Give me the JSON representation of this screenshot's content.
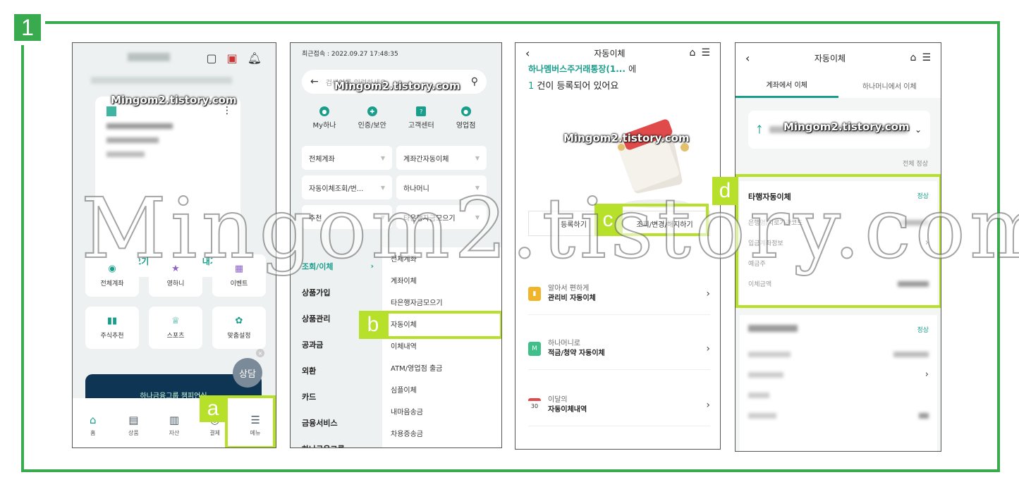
{
  "step": "1",
  "watermark": {
    "small": "Mingom2.tistory.com",
    "large": "Mingom2.tistory.com"
  },
  "callouts": {
    "a": "a",
    "b": "b",
    "c": "c",
    "d": "d"
  },
  "colors": {
    "frame": "#3aaa4f",
    "callout": "#b6e02a",
    "brand": "#1a9e8c"
  },
  "phone1": {
    "top_icons": [
      "wallet-icon",
      "qr-icon",
      "bell-icon"
    ],
    "card_buttons": [
      "가져오기",
      "보내기"
    ],
    "tiles": [
      "전체계좌",
      "영하니",
      "이벤트",
      "주식추천",
      "스포츠",
      "맞춤설정"
    ],
    "banner_text": "하나금융그룹 챔피언십",
    "consult": "상담",
    "nav": [
      "홈",
      "상품",
      "자산",
      "결제",
      "메뉴"
    ]
  },
  "phone2": {
    "last_login": "최근접속 : 2022.09.27 17:48:35",
    "search_placeholder": "검색어를 입력하세요",
    "quick": [
      "My하나",
      "인증/보안",
      "고객센터",
      "영업점"
    ],
    "chips": [
      "전체계좌",
      "계좌간자동이체",
      "자동이체조회/번...",
      "하나머니",
      "추천",
      "타은행자금모으기"
    ],
    "categories": [
      "조회/이체",
      "상품가입",
      "상품관리",
      "공과금",
      "외환",
      "카드",
      "금융서비스",
      "하나금융그룹"
    ],
    "sub_items": [
      "전체계좌",
      "계좌이체",
      "타은행자금모으기",
      "자동이체",
      "이체내역",
      "ATM/영업점 출금",
      "심플이체",
      "내마음송금",
      "차용증송금"
    ]
  },
  "phone3": {
    "title": "자동이체",
    "account_line": "하나멤버스주거래통장(1...",
    "account_suffix": "에",
    "count_num": "1",
    "count_text": " 건이 등록되어 있어요",
    "tab_register": "등록하기",
    "tab_manage": "조회/변경/해지하기",
    "rows": [
      {
        "sub": "알아서 편하게",
        "main": "관리비 자동이체"
      },
      {
        "sub": "하나머니로",
        "main": "적금/청약 자동이체"
      },
      {
        "sub": "이달의",
        "main": "자동이체내역"
      }
    ]
  },
  "phone4": {
    "title": "자동이체",
    "tabs": [
      "계좌에서 이체",
      "하나머니에서 이체"
    ],
    "filter": "전체 정상",
    "card": {
      "title": "타행자동이체",
      "status": "정상",
      "labels": [
        "은행명/지로기관코드",
        "입금계좌정보",
        "예금주",
        "이체금액"
      ]
    },
    "card2_status": "정상"
  }
}
